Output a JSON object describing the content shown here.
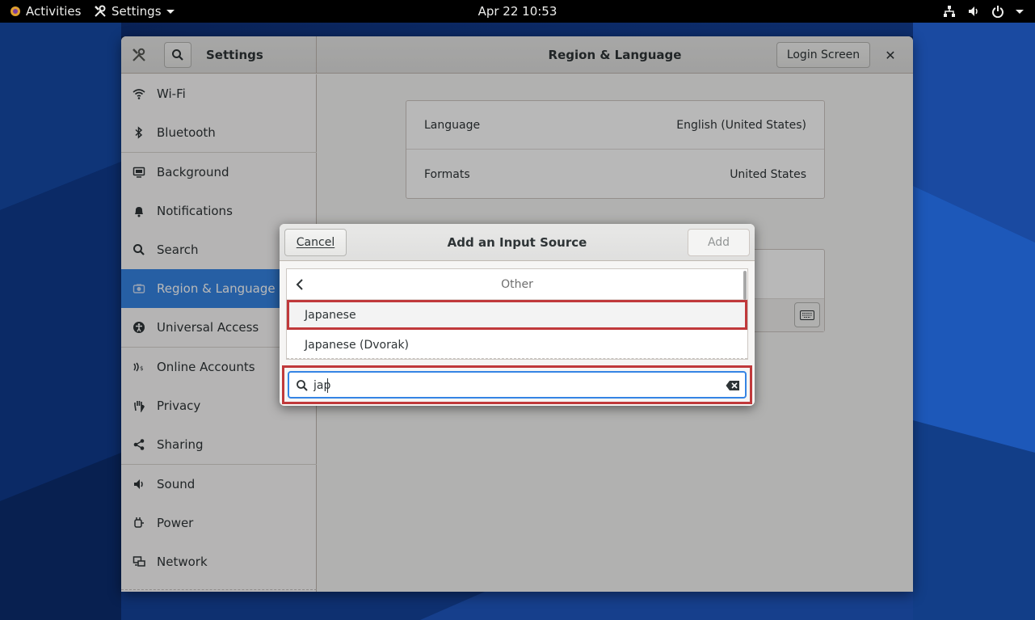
{
  "topbar": {
    "activities": "Activities",
    "app_menu": "Settings",
    "clock": "Apr 22  10:53"
  },
  "window": {
    "app_title": "Settings",
    "page_title": "Region & Language",
    "login_screen_label": "Login Screen",
    "close_label": "✕"
  },
  "sidebar": {
    "items": [
      {
        "label": "Wi-Fi",
        "icon": "wifi-icon"
      },
      {
        "label": "Bluetooth",
        "icon": "bluetooth-icon"
      },
      {
        "label": "Background",
        "icon": "background-icon"
      },
      {
        "label": "Notifications",
        "icon": "bell-icon"
      },
      {
        "label": "Search",
        "icon": "search-icon"
      },
      {
        "label": "Region & Language",
        "icon": "camera-icon",
        "active": true
      },
      {
        "label": "Universal Access",
        "icon": "accessibility-icon"
      },
      {
        "label": "Online Accounts",
        "icon": "online-accounts-icon"
      },
      {
        "label": "Privacy",
        "icon": "hand-icon"
      },
      {
        "label": "Sharing",
        "icon": "share-icon"
      },
      {
        "label": "Sound",
        "icon": "speaker-icon"
      },
      {
        "label": "Power",
        "icon": "power-plug-icon"
      },
      {
        "label": "Network",
        "icon": "network-icon"
      }
    ]
  },
  "region": {
    "language_label": "Language",
    "language_value": "English (United States)",
    "formats_label": "Formats",
    "formats_value": "United States"
  },
  "dialog": {
    "title": "Add an Input Source",
    "cancel_label": "Cancel",
    "add_label": "Add",
    "list_header": "Other",
    "items": [
      "Japanese",
      "Japanese (Dvorak)"
    ],
    "search_value": "jap"
  },
  "colors": {
    "accent": "#3584e4",
    "highlight_border": "#c0393b"
  }
}
